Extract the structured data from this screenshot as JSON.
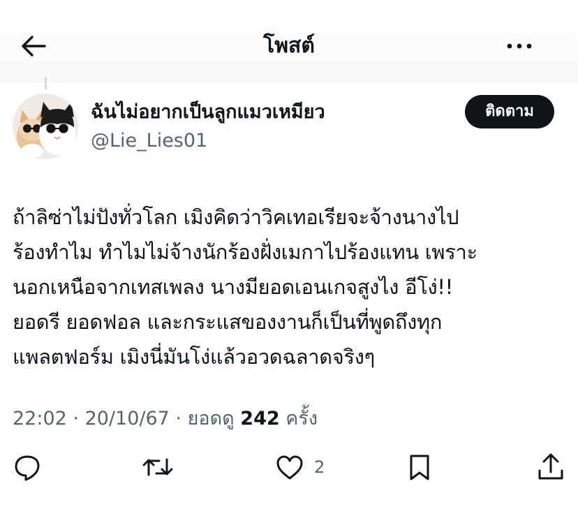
{
  "header": {
    "title": "โพสต์"
  },
  "author": {
    "display_name": "ฉันไม่อยากเป็นลูกแมวเหมียว",
    "handle": "@Lie_Lies01"
  },
  "follow_button": {
    "label": "ติดตาม"
  },
  "post": {
    "lines": [
      "ถ้าลิซ่าไม่ปังทั่วโลก เมิงคิดว่าวิคเทอเรียจะจ้างนางไป",
      "ร้องทำไม ทำไมไม่จ้างนักร้องฝั่งเมกาไปร้องแทน เพราะ",
      "นอกเหนือจากเทสเพลง นางมียอดเอนเกจสูงไง อีโง่!!",
      "ยอดรี ยอดฟอล และกระแสของงานก็เป็นที่พูดถึงทุก",
      "แพลตฟอร์ม เมิงนี่มันโง่แล้วอวดฉลาดจริงๆ"
    ]
  },
  "meta": {
    "time": "22:02",
    "separator": " · ",
    "date": "20/10/67",
    "views_label": "ยอดดู",
    "views_count": "242",
    "views_suffix": "ครั้ง"
  },
  "actions": {
    "like_count": "2"
  },
  "icons": {
    "back": "arrow-left-icon",
    "more": "more-horizontal-icon",
    "reply": "reply-bubble-icon",
    "repost": "repost-icon",
    "like": "heart-icon",
    "bookmark": "bookmark-icon",
    "share": "share-upload-icon"
  },
  "colors": {
    "text": "#0f1419",
    "secondary": "#536471",
    "follow_bg": "#0f1419"
  }
}
